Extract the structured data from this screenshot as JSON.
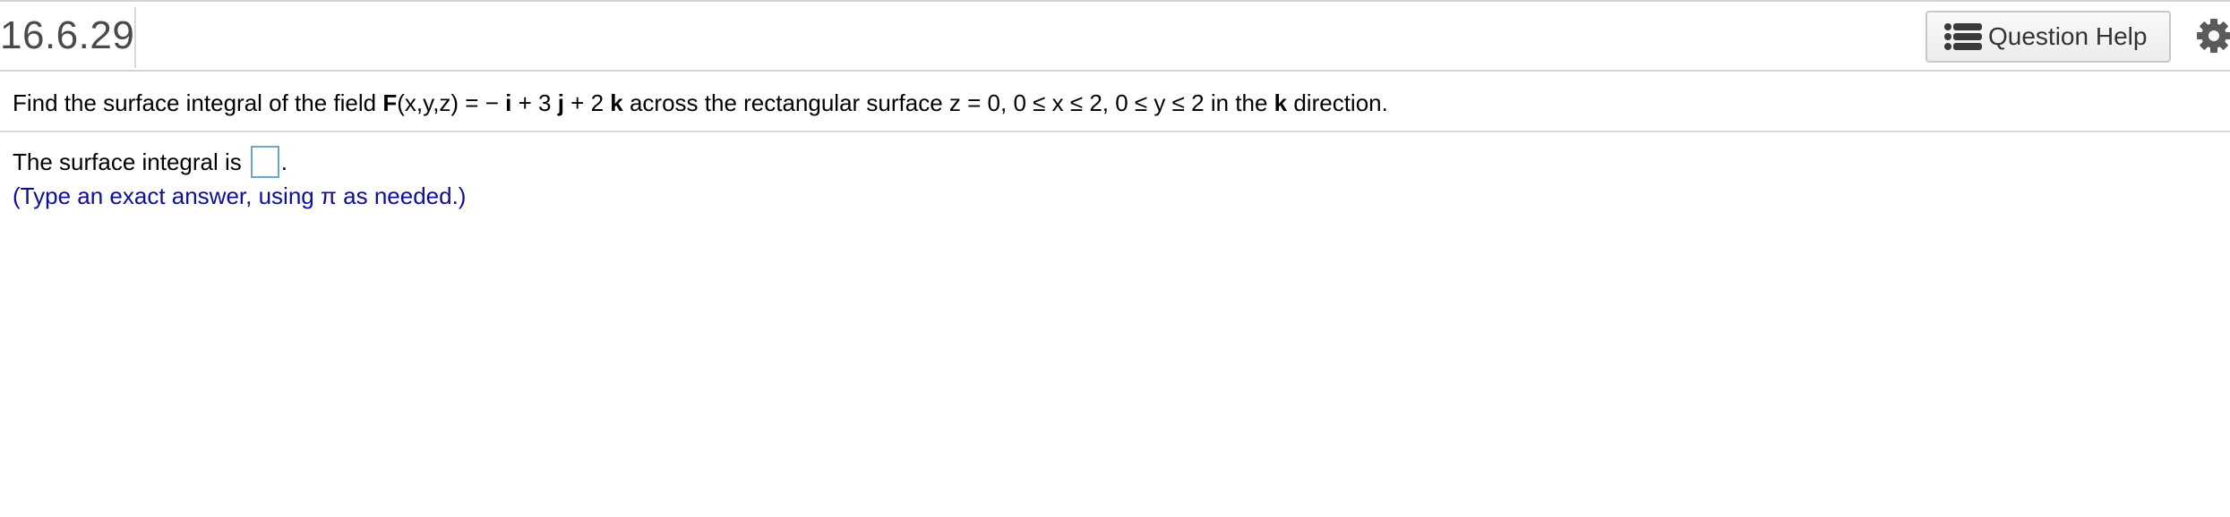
{
  "header": {
    "question_number": "16.6.29",
    "help_button_label": "Question Help",
    "help_icon": "list-icon",
    "settings_icon": "gear-icon"
  },
  "question": {
    "prompt_prefix": "Find the surface integral of the field ",
    "field_symbol": "F",
    "field_args": "(x,y,z) = −",
    "unit_i": "i",
    "between_i_j": " + 3",
    "unit_j": "j",
    "between_j_k": " + 2",
    "unit_k": "k",
    "prompt_middle": " across the rectangular surface z = 0, 0 ≤ x ≤ 2, 0 ≤ y ≤ 2 in the ",
    "direction_symbol": "k",
    "prompt_suffix": " direction."
  },
  "answer": {
    "label": "The surface integral is",
    "value": "",
    "after_box": ".",
    "hint": "(Type an exact answer, using π as needed.)"
  },
  "colors": {
    "hint_text": "#0e0e9a",
    "answer_box_border": "#6fa6c8",
    "divider": "#d4d4d4"
  }
}
